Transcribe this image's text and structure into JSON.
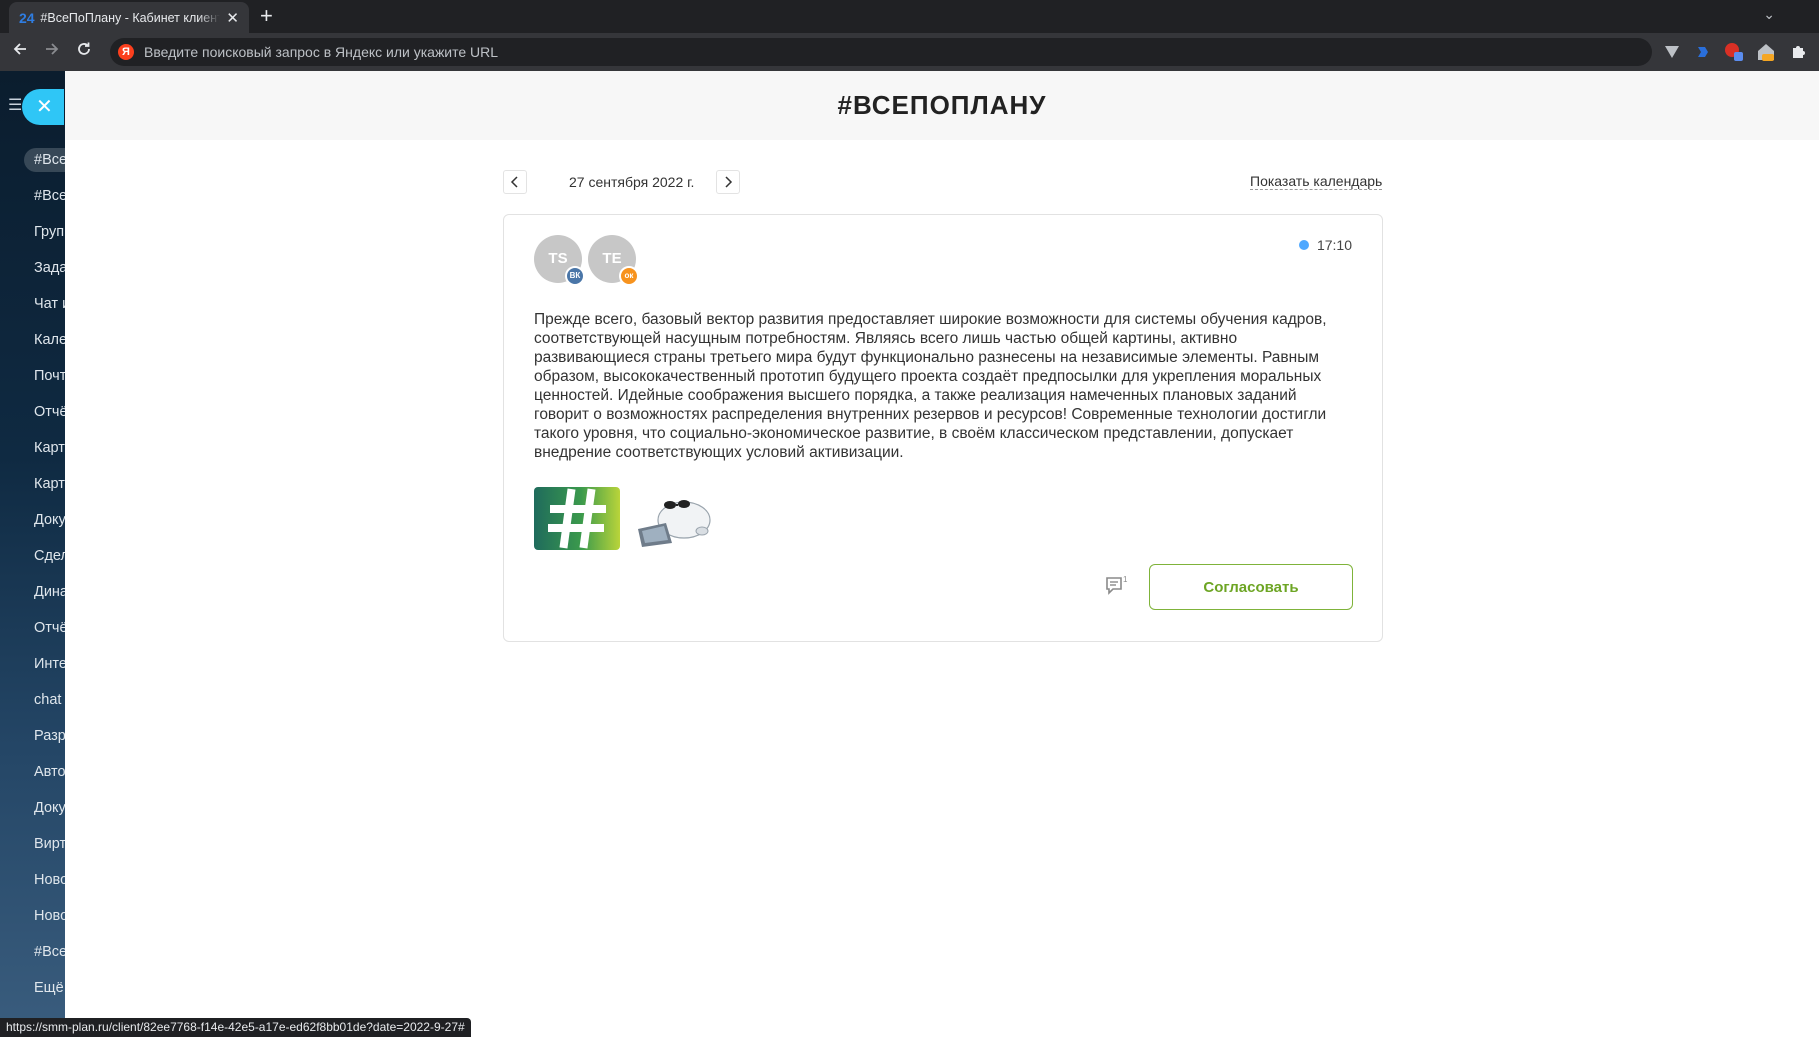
{
  "browser": {
    "tab_favicon": "24",
    "tab_title": "#ВсеПоПлану - Кабинет клиента",
    "address_placeholder": "Введите поисковый запрос в Яндекс или укажите URL",
    "status_url": "https://smm-plan.ru/client/82ee7768-f14e-42e5-a17e-ed62f8bb01de?date=2022-9-27#"
  },
  "sidebar": {
    "items": [
      {
        "label": "#ВсеПоПлану"
      },
      {
        "label": "#ВсеПоПлану"
      },
      {
        "label": "Группы"
      },
      {
        "label": "Задачи"
      },
      {
        "label": "Чат и звонки"
      },
      {
        "label": "Календарь"
      },
      {
        "label": "Почта"
      },
      {
        "label": "Отчёты"
      },
      {
        "label": "Карты"
      },
      {
        "label": "Карточки"
      },
      {
        "label": "Документы"
      },
      {
        "label": "Сделки"
      },
      {
        "label": "Динамика"
      },
      {
        "label": "Отчёты"
      },
      {
        "label": "Интеграции"
      },
      {
        "label": "chat"
      },
      {
        "label": "Разработка"
      },
      {
        "label": "Автоматизация"
      },
      {
        "label": "Документы"
      },
      {
        "label": "Виртуальная АТС"
      },
      {
        "label": "Новости"
      },
      {
        "label": "Новости"
      },
      {
        "label": "#ВсеПоПлану"
      },
      {
        "label": "Ещё"
      }
    ]
  },
  "page": {
    "title": "#ВСЕПОПЛАНУ",
    "date": "27 сентября 2022 г.",
    "show_calendar": "Показать календарь"
  },
  "post": {
    "time": "17:10",
    "accounts": [
      {
        "initials": "TS",
        "network": "vk-icon",
        "badge": "ВК",
        "badge_color": "#4a76a8"
      },
      {
        "initials": "TE",
        "network": "ok-icon",
        "badge": "ок",
        "badge_color": "#f7931e"
      }
    ],
    "text": "Прежде всего, базовый вектор развития предоставляет широкие возможности для системы обучения кадров, соответствующей насущным потребностям. Являясь всего лишь частью общей картины, активно развивающиеся страны третьего мира будут функционально разнесены на независимые элементы. Равным образом, высококачественный прототип будущего проекта создаёт предпосылки для укрепления моральных ценностей. Идейные соображения высшего порядка, а также реализация намеченных плановых заданий говорит о возможностях распределения внутренних резервов и ресурсов! Современные технологии достигли такого уровня, что социально-экономическое развитие, в своём классическом представлении, допускает внедрение соответствующих условий активизации.",
    "approve_label": "Согласовать",
    "comment_count": "1"
  },
  "colors": {
    "accent_green": "#6da524",
    "sidebar_close": "#2fc6f6",
    "time_dot": "#4ea8ff"
  }
}
